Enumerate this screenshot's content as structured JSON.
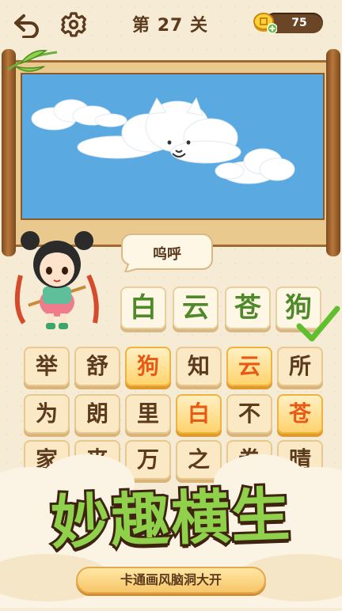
{
  "header": {
    "level_title": "第 27 关",
    "coins": "75",
    "back_icon": "back-arrow-icon",
    "settings_icon": "gear-icon",
    "coin_icon": "coin-add-icon"
  },
  "puzzle": {
    "speech_text": "呜呼"
  },
  "answer": {
    "characters": [
      "白",
      "云",
      "苍",
      "狗"
    ],
    "color": "#4f8a2a",
    "solved_icon": "checkmark-icon"
  },
  "grid": {
    "rows": [
      [
        {
          "c": "举",
          "h": false
        },
        {
          "c": "舒",
          "h": false
        },
        {
          "c": "狗",
          "h": true
        },
        {
          "c": "知",
          "h": false
        },
        {
          "c": "云",
          "h": true
        },
        {
          "c": "所",
          "h": false
        }
      ],
      [
        {
          "c": "为",
          "h": false
        },
        {
          "c": "朗",
          "h": false
        },
        {
          "c": "里",
          "h": false
        },
        {
          "c": "白",
          "h": true
        },
        {
          "c": "不",
          "h": false
        },
        {
          "c": "苍",
          "h": true
        }
      ],
      [
        {
          "c": "家",
          "h": false
        },
        {
          "c": "丧",
          "h": false
        },
        {
          "c": "万",
          "h": false
        },
        {
          "c": "之",
          "h": false
        },
        {
          "c": "卷",
          "h": false
        },
        {
          "c": "晴",
          "h": false
        }
      ]
    ],
    "highlight_color": "#e85a14"
  },
  "promo": {
    "slogan": "妙趣横生",
    "tagline": "卡通画风脑洞大开",
    "slogan_color": "#8fd14a"
  }
}
